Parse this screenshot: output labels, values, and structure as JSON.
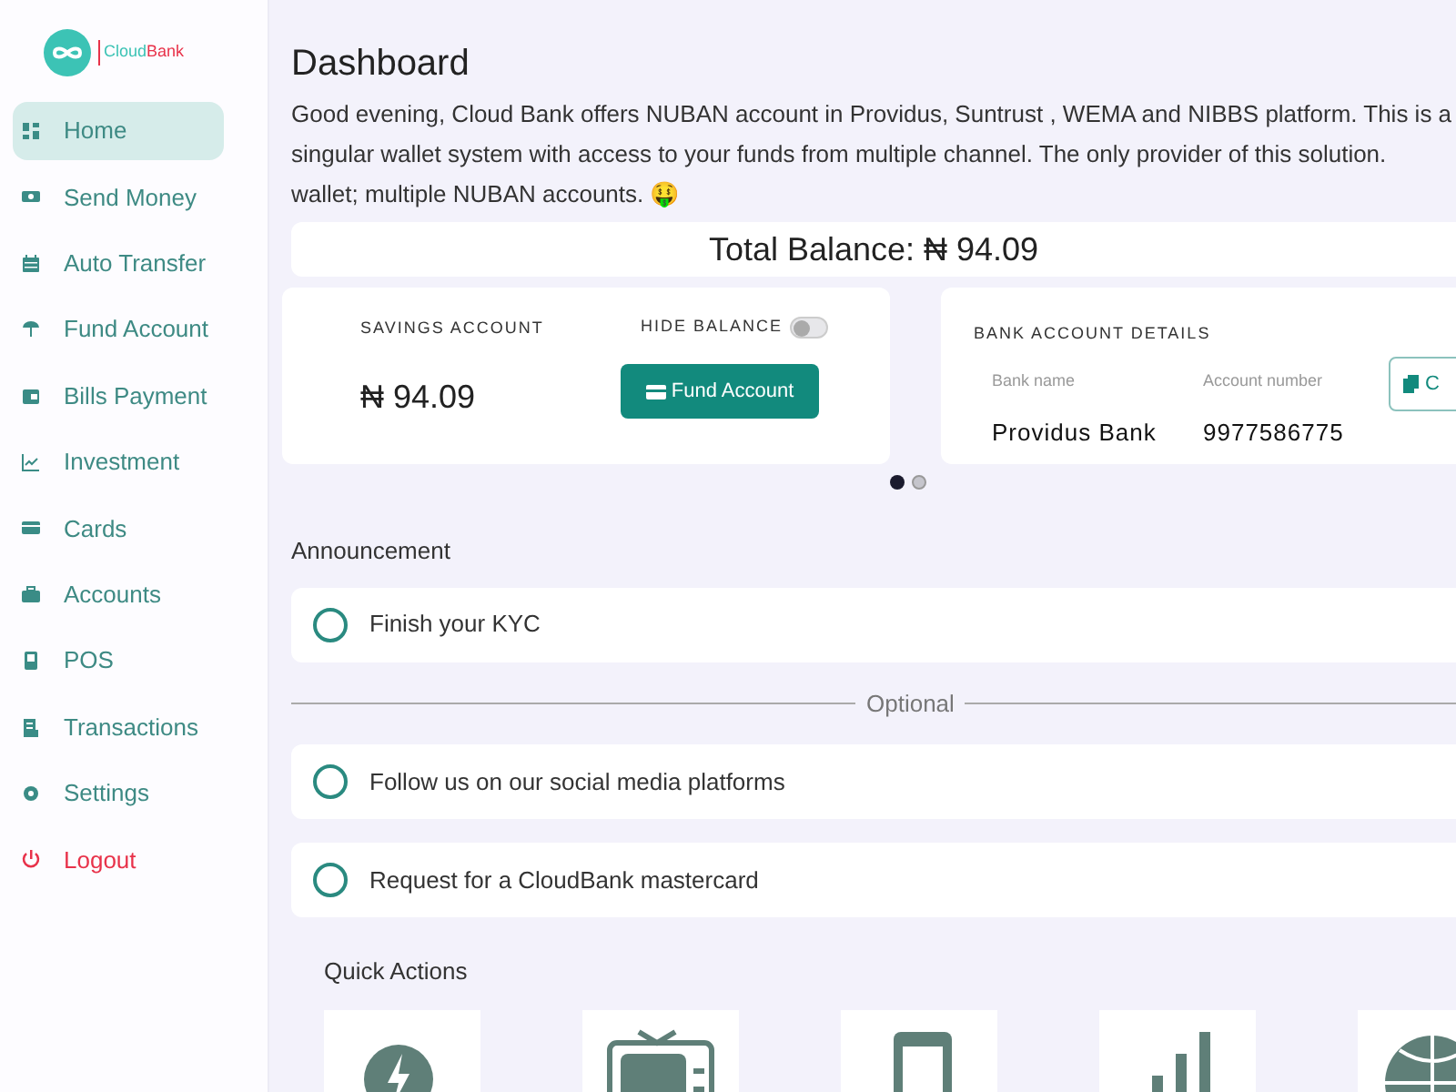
{
  "logo": {
    "text_a": "Cloud",
    "text_b": "Bank"
  },
  "sidebar": {
    "items": [
      {
        "label": "Home",
        "kind": "nav",
        "selected": true
      },
      {
        "label": "Send Money",
        "kind": "nav",
        "selected": false
      },
      {
        "label": "Auto Transfer",
        "kind": "nav",
        "selected": false
      },
      {
        "label": "Fund Account",
        "kind": "nav",
        "selected": false
      },
      {
        "label": "Bills Payment",
        "kind": "nav",
        "selected": false
      },
      {
        "label": "Investment",
        "kind": "nav",
        "selected": false
      },
      {
        "label": "Cards",
        "kind": "nav",
        "selected": false
      },
      {
        "label": "Accounts",
        "kind": "nav",
        "selected": false
      },
      {
        "label": "POS",
        "kind": "nav",
        "selected": false
      },
      {
        "label": "Transactions",
        "kind": "nav",
        "selected": false
      },
      {
        "label": "Settings",
        "kind": "nav",
        "selected": false
      },
      {
        "label": "Logout",
        "kind": "danger",
        "selected": false
      }
    ]
  },
  "page": {
    "title": "Dashboard",
    "intro_lines": [
      "Good evening, Cloud Bank offers NUBAN account in Providus, Suntrust , WEMA and NIBBS platform. This is a",
      "singular wallet system with access to your funds from multiple channel. The only provider of this solution.",
      "wallet; multiple NUBAN accounts. 🤑"
    ]
  },
  "total_balance": "Total Balance: ₦ 94.09",
  "savings_card": {
    "label": "SAVINGS ACCOUNT",
    "hide_balance_label": "HIDE BALANCE",
    "hide_balance": false,
    "amount": "₦ 94.09",
    "button": "Fund Account"
  },
  "bank_card": {
    "title": "BANK ACCOUNT DETAILS",
    "columns": [
      "Bank name",
      "Account number"
    ],
    "values": [
      "Providus Bank",
      "9977586775"
    ],
    "copy_button": "C"
  },
  "carousel_dots": [
    {
      "selected": true
    },
    {
      "selected": false
    }
  ],
  "announcement": {
    "title": "Announcement",
    "items": [
      {
        "text": "Finish your KYC",
        "checked": false
      }
    ],
    "divider": "Optional",
    "optional_items": [
      {
        "text": "Follow us on our social media platforms",
        "checked": false
      },
      {
        "text": "Request for a CloudBank mastercard",
        "checked": false
      }
    ]
  },
  "quick_actions": {
    "title": "Quick Actions"
  }
}
